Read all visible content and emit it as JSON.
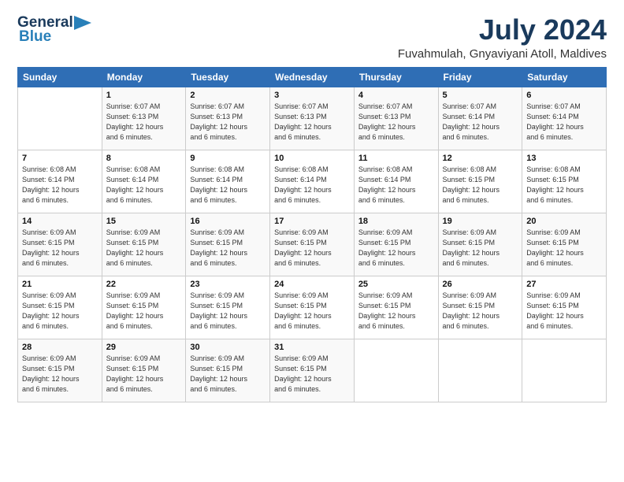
{
  "logo": {
    "general": "General",
    "blue": "Blue"
  },
  "title": {
    "month": "July 2024",
    "location": "Fuvahmulah, Gnyaviyani Atoll, Maldives"
  },
  "weekdays": [
    "Sunday",
    "Monday",
    "Tuesday",
    "Wednesday",
    "Thursday",
    "Friday",
    "Saturday"
  ],
  "weeks": [
    [
      {
        "day": "",
        "sunrise": "",
        "sunset": "",
        "daylight": ""
      },
      {
        "day": "1",
        "sunrise": "Sunrise: 6:07 AM",
        "sunset": "Sunset: 6:13 PM",
        "daylight": "Daylight: 12 hours and 6 minutes."
      },
      {
        "day": "2",
        "sunrise": "Sunrise: 6:07 AM",
        "sunset": "Sunset: 6:13 PM",
        "daylight": "Daylight: 12 hours and 6 minutes."
      },
      {
        "day": "3",
        "sunrise": "Sunrise: 6:07 AM",
        "sunset": "Sunset: 6:13 PM",
        "daylight": "Daylight: 12 hours and 6 minutes."
      },
      {
        "day": "4",
        "sunrise": "Sunrise: 6:07 AM",
        "sunset": "Sunset: 6:13 PM",
        "daylight": "Daylight: 12 hours and 6 minutes."
      },
      {
        "day": "5",
        "sunrise": "Sunrise: 6:07 AM",
        "sunset": "Sunset: 6:14 PM",
        "daylight": "Daylight: 12 hours and 6 minutes."
      },
      {
        "day": "6",
        "sunrise": "Sunrise: 6:07 AM",
        "sunset": "Sunset: 6:14 PM",
        "daylight": "Daylight: 12 hours and 6 minutes."
      }
    ],
    [
      {
        "day": "7",
        "sunrise": "Sunrise: 6:08 AM",
        "sunset": "Sunset: 6:14 PM",
        "daylight": "Daylight: 12 hours and 6 minutes."
      },
      {
        "day": "8",
        "sunrise": "Sunrise: 6:08 AM",
        "sunset": "Sunset: 6:14 PM",
        "daylight": "Daylight: 12 hours and 6 minutes."
      },
      {
        "day": "9",
        "sunrise": "Sunrise: 6:08 AM",
        "sunset": "Sunset: 6:14 PM",
        "daylight": "Daylight: 12 hours and 6 minutes."
      },
      {
        "day": "10",
        "sunrise": "Sunrise: 6:08 AM",
        "sunset": "Sunset: 6:14 PM",
        "daylight": "Daylight: 12 hours and 6 minutes."
      },
      {
        "day": "11",
        "sunrise": "Sunrise: 6:08 AM",
        "sunset": "Sunset: 6:14 PM",
        "daylight": "Daylight: 12 hours and 6 minutes."
      },
      {
        "day": "12",
        "sunrise": "Sunrise: 6:08 AM",
        "sunset": "Sunset: 6:15 PM",
        "daylight": "Daylight: 12 hours and 6 minutes."
      },
      {
        "day": "13",
        "sunrise": "Sunrise: 6:08 AM",
        "sunset": "Sunset: 6:15 PM",
        "daylight": "Daylight: 12 hours and 6 minutes."
      }
    ],
    [
      {
        "day": "14",
        "sunrise": "Sunrise: 6:09 AM",
        "sunset": "Sunset: 6:15 PM",
        "daylight": "Daylight: 12 hours and 6 minutes."
      },
      {
        "day": "15",
        "sunrise": "Sunrise: 6:09 AM",
        "sunset": "Sunset: 6:15 PM",
        "daylight": "Daylight: 12 hours and 6 minutes."
      },
      {
        "day": "16",
        "sunrise": "Sunrise: 6:09 AM",
        "sunset": "Sunset: 6:15 PM",
        "daylight": "Daylight: 12 hours and 6 minutes."
      },
      {
        "day": "17",
        "sunrise": "Sunrise: 6:09 AM",
        "sunset": "Sunset: 6:15 PM",
        "daylight": "Daylight: 12 hours and 6 minutes."
      },
      {
        "day": "18",
        "sunrise": "Sunrise: 6:09 AM",
        "sunset": "Sunset: 6:15 PM",
        "daylight": "Daylight: 12 hours and 6 minutes."
      },
      {
        "day": "19",
        "sunrise": "Sunrise: 6:09 AM",
        "sunset": "Sunset: 6:15 PM",
        "daylight": "Daylight: 12 hours and 6 minutes."
      },
      {
        "day": "20",
        "sunrise": "Sunrise: 6:09 AM",
        "sunset": "Sunset: 6:15 PM",
        "daylight": "Daylight: 12 hours and 6 minutes."
      }
    ],
    [
      {
        "day": "21",
        "sunrise": "Sunrise: 6:09 AM",
        "sunset": "Sunset: 6:15 PM",
        "daylight": "Daylight: 12 hours and 6 minutes."
      },
      {
        "day": "22",
        "sunrise": "Sunrise: 6:09 AM",
        "sunset": "Sunset: 6:15 PM",
        "daylight": "Daylight: 12 hours and 6 minutes."
      },
      {
        "day": "23",
        "sunrise": "Sunrise: 6:09 AM",
        "sunset": "Sunset: 6:15 PM",
        "daylight": "Daylight: 12 hours and 6 minutes."
      },
      {
        "day": "24",
        "sunrise": "Sunrise: 6:09 AM",
        "sunset": "Sunset: 6:15 PM",
        "daylight": "Daylight: 12 hours and 6 minutes."
      },
      {
        "day": "25",
        "sunrise": "Sunrise: 6:09 AM",
        "sunset": "Sunset: 6:15 PM",
        "daylight": "Daylight: 12 hours and 6 minutes."
      },
      {
        "day": "26",
        "sunrise": "Sunrise: 6:09 AM",
        "sunset": "Sunset: 6:15 PM",
        "daylight": "Daylight: 12 hours and 6 minutes."
      },
      {
        "day": "27",
        "sunrise": "Sunrise: 6:09 AM",
        "sunset": "Sunset: 6:15 PM",
        "daylight": "Daylight: 12 hours and 6 minutes."
      }
    ],
    [
      {
        "day": "28",
        "sunrise": "Sunrise: 6:09 AM",
        "sunset": "Sunset: 6:15 PM",
        "daylight": "Daylight: 12 hours and 6 minutes."
      },
      {
        "day": "29",
        "sunrise": "Sunrise: 6:09 AM",
        "sunset": "Sunset: 6:15 PM",
        "daylight": "Daylight: 12 hours and 6 minutes."
      },
      {
        "day": "30",
        "sunrise": "Sunrise: 6:09 AM",
        "sunset": "Sunset: 6:15 PM",
        "daylight": "Daylight: 12 hours and 6 minutes."
      },
      {
        "day": "31",
        "sunrise": "Sunrise: 6:09 AM",
        "sunset": "Sunset: 6:15 PM",
        "daylight": "Daylight: 12 hours and 6 minutes."
      },
      {
        "day": "",
        "sunrise": "",
        "sunset": "",
        "daylight": ""
      },
      {
        "day": "",
        "sunrise": "",
        "sunset": "",
        "daylight": ""
      },
      {
        "day": "",
        "sunrise": "",
        "sunset": "",
        "daylight": ""
      }
    ]
  ]
}
